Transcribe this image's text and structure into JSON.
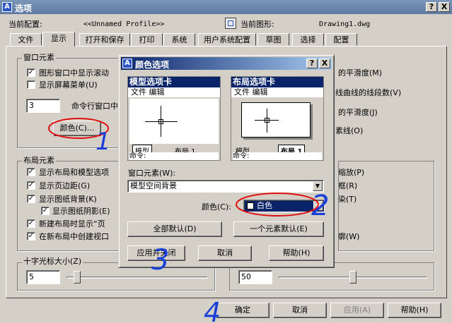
{
  "window": {
    "title": "选项",
    "help_btn": "?",
    "close_btn": "X"
  },
  "profile": {
    "label": "当前配置:",
    "value": "<<Unnamed Profile>>",
    "drawing_label": "当前图形:",
    "drawing_value": "Drawing1.dwg"
  },
  "tabs": [
    "文件",
    "显示",
    "打开和保存",
    "打印",
    "系统",
    "用户系统配置",
    "草图",
    "选择",
    "配置"
  ],
  "window_elements": {
    "title": "窗口元素",
    "items": [
      {
        "label": "图形窗口中显示滚动",
        "checked": true
      },
      {
        "label": "显示屏幕菜单(U)",
        "checked": false
      }
    ],
    "cmd_lines_value": "3",
    "cmd_lines_label": "命令行窗口中",
    "color_button": "颜色(C)..."
  },
  "right_items": [
    "的平滑度(M)",
    "线曲线的线段数(V)",
    "的平滑度(J)",
    "素线(O)"
  ],
  "layout_elements": {
    "title": "布局元素",
    "items": [
      {
        "label": "显示布局和模型选项",
        "checked": true,
        "indent": false
      },
      {
        "label": "显示页边距(G)",
        "checked": true,
        "indent": false
      },
      {
        "label": "显示图纸背景(K)",
        "checked": true,
        "indent": false
      },
      {
        "label": "显示图纸阴影(E)",
        "checked": true,
        "indent": true
      },
      {
        "label": "新建布局时显示“页",
        "checked": true,
        "indent": false
      },
      {
        "label": "在新布局中创建视口",
        "checked": true,
        "indent": false
      }
    ]
  },
  "right_items2": [
    "缩放(P)",
    "框(R)",
    "染(T)",
    "",
    "",
    "廓(W)"
  ],
  "crosshair": {
    "title": "十字光标大小(Z)",
    "value": "5",
    "slider_fraction": 0.05
  },
  "fade": {
    "value": "50",
    "slider_fraction": 0.5
  },
  "buttons": {
    "ok": "确定",
    "cancel": "取消",
    "apply": "应用(A)",
    "help": "帮助(H)"
  },
  "color_dialog": {
    "title": "颜色选项",
    "help_btn": "?",
    "close_btn": "X",
    "model_tab": {
      "header": "模型选项卡",
      "menu": "文件 编辑",
      "tab_model": "模型",
      "tab_layout": "布局 1",
      "cmd": "命令:"
    },
    "layout_tab": {
      "header": "布局选项卡",
      "menu": "文件 编辑",
      "tab_model": "模型",
      "tab_layout": "布局 1",
      "cmd": "命令:"
    },
    "element_label": "窗口元素(W):",
    "element_value": "模型空间背景",
    "color_label": "颜色(C):",
    "color_value": "白色",
    "btn_default_all": "全部默认(D)",
    "btn_default_one": "一个元素默认(E)",
    "btn_apply_close": "应用并关闭",
    "btn_cancel": "取消",
    "btn_help": "帮助(H)"
  },
  "annotations": [
    "1",
    "2",
    "3",
    "4"
  ]
}
